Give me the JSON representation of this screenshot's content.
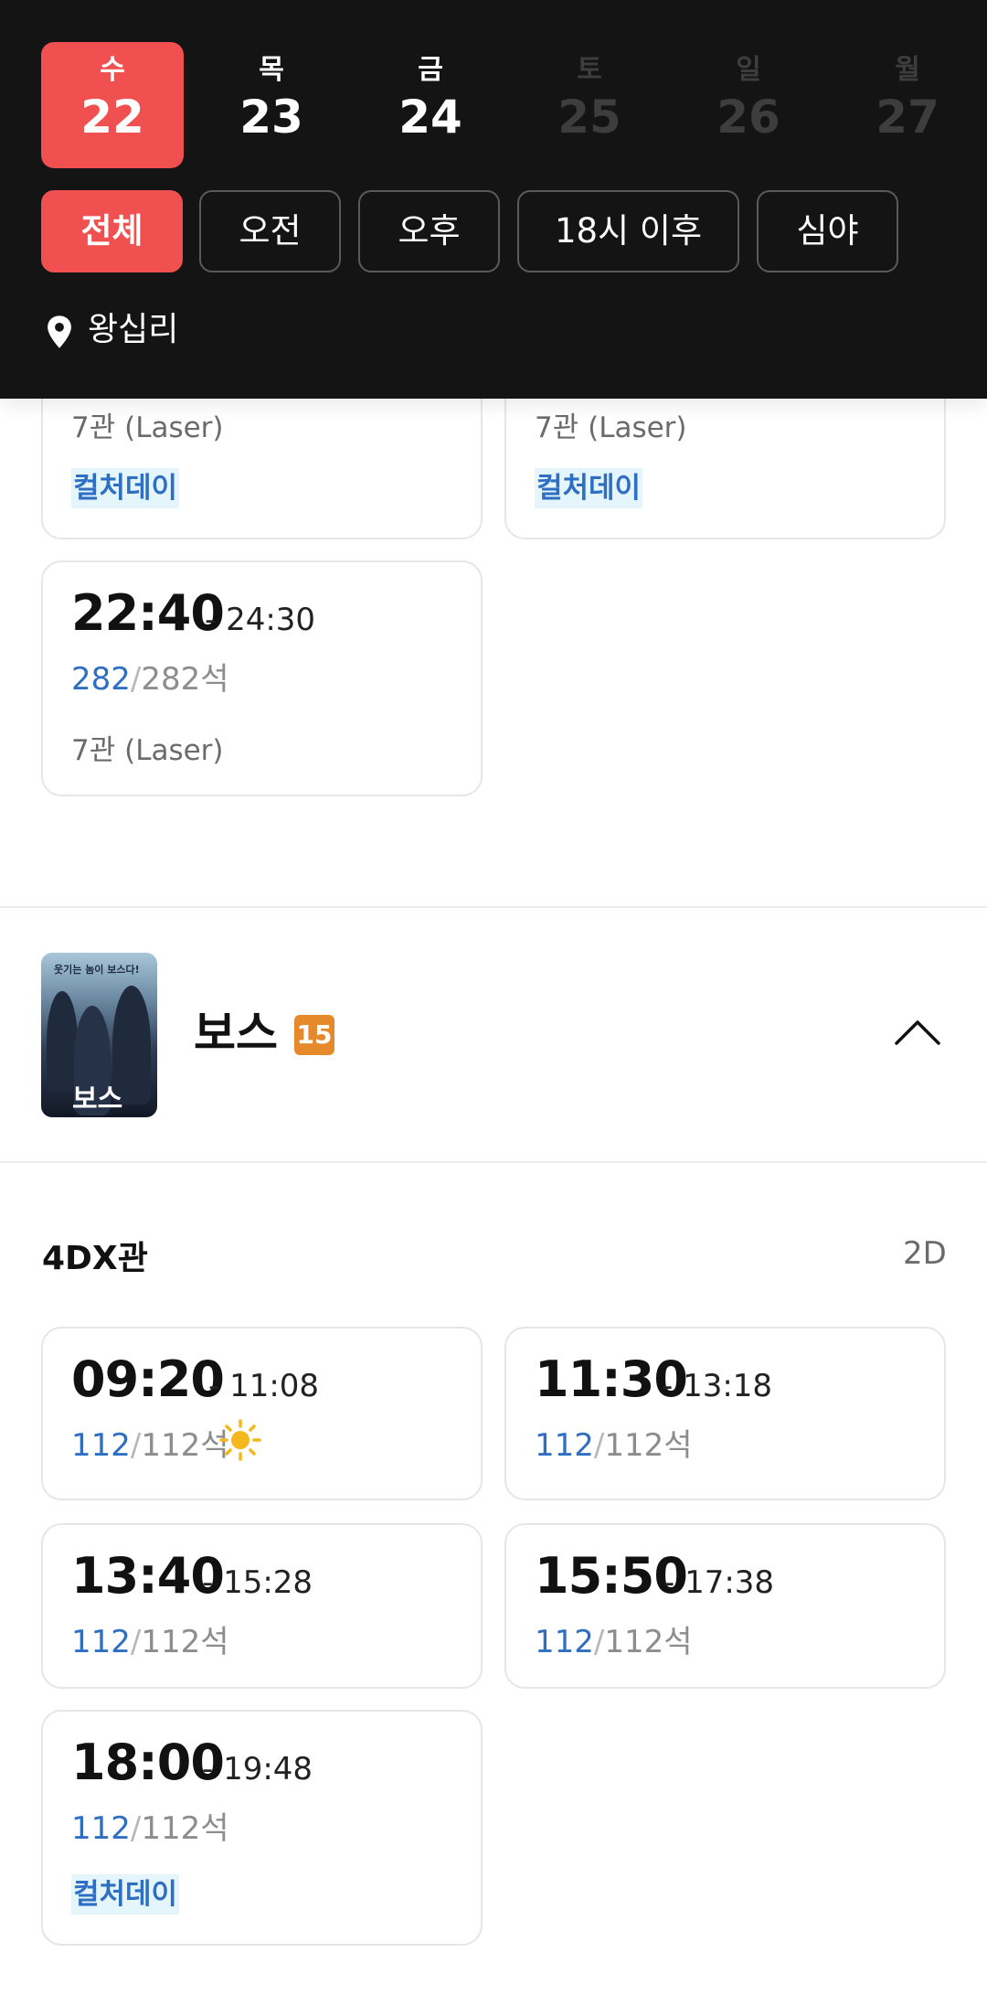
{
  "dates": [
    {
      "dow": "수",
      "day": "22",
      "state": "active"
    },
    {
      "dow": "목",
      "day": "23",
      "state": "normal"
    },
    {
      "dow": "금",
      "day": "24",
      "state": "normal"
    },
    {
      "dow": "토",
      "day": "25",
      "state": "disabled"
    },
    {
      "dow": "일",
      "day": "26",
      "state": "disabled"
    },
    {
      "dow": "월",
      "day": "27",
      "state": "disabled"
    }
  ],
  "filters": [
    "전체",
    "오전",
    "오후",
    "18시 이후",
    "심야"
  ],
  "location": {
    "name": "왕십리",
    "icon": "location-pin-icon"
  },
  "prev_movie": {
    "top_cards": [
      {
        "hall": "7관 (Laser)",
        "badge": "컬처데이"
      },
      {
        "hall": "7관 (Laser)",
        "badge": "컬처데이"
      }
    ],
    "last_card": {
      "start": "22:40",
      "end": "- 24:30",
      "seats_available": "282",
      "seats_total": "282석",
      "hall": "7관 (Laser)"
    }
  },
  "movie": {
    "title": "보스",
    "rating": "15",
    "poster_tagline": "웃기는 놈이 보스다!",
    "poster_title": "보스",
    "collapse_icon": "chevron-up-icon"
  },
  "section": {
    "name": "4DX관",
    "format": "2D"
  },
  "showtimes": [
    {
      "start": "09:20",
      "end": "- 11:08",
      "seats_available": "112",
      "seats_total": "112석",
      "icon": "sun-icon"
    },
    {
      "start": "11:30",
      "end": "- 13:18",
      "seats_available": "112",
      "seats_total": "112석"
    },
    {
      "start": "13:40",
      "end": "- 15:28",
      "seats_available": "112",
      "seats_total": "112석"
    },
    {
      "start": "15:50",
      "end": "- 17:38",
      "seats_available": "112",
      "seats_total": "112석"
    },
    {
      "start": "18:00",
      "end": "- 19:48",
      "seats_available": "112",
      "seats_total": "112석",
      "badge": "컬처데이"
    }
  ],
  "colors": {
    "accent": "#f0504f",
    "seat_blue": "#2f6fc3",
    "header_bg": "#141414",
    "rating_orange": "#e5892b"
  }
}
